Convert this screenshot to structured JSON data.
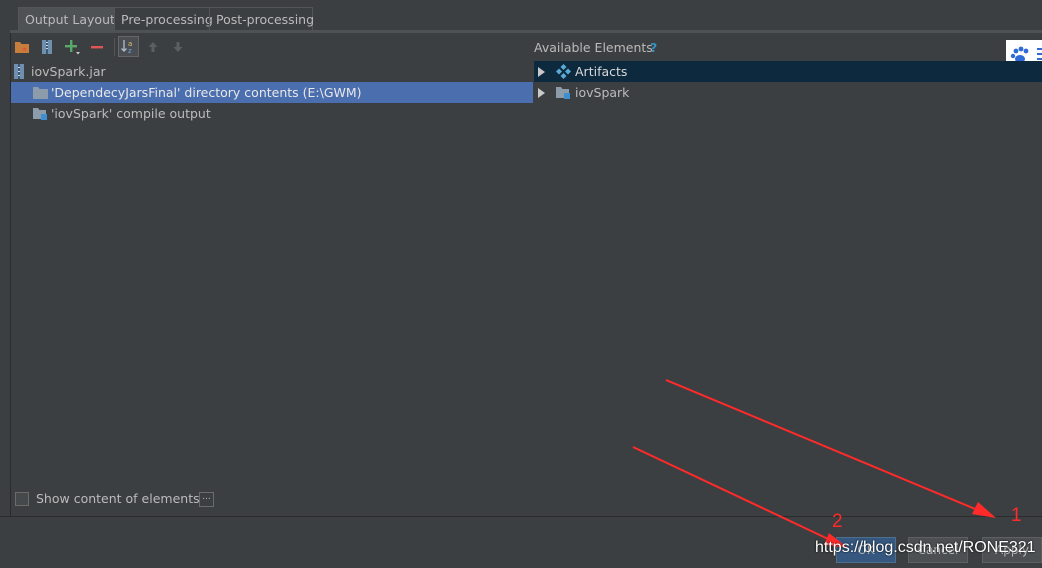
{
  "tabs": [
    {
      "label": "Output Layout",
      "active": true
    },
    {
      "label": "Pre-processing",
      "active": false
    },
    {
      "label": "Post-processing",
      "active": false
    }
  ],
  "toolbar": {
    "icons": [
      "create-directory-icon",
      "archive-icon",
      "add-icon",
      "remove-icon",
      "sort-icon",
      "move-up-icon",
      "move-down-icon"
    ]
  },
  "output_tree": {
    "root": "iovSpark.jar",
    "items": [
      {
        "label": "'DependecyJarsFinal' directory contents (E:\\GWM)",
        "selected": true
      },
      {
        "label": "'iovSpark' compile output",
        "selected": false
      }
    ]
  },
  "available": {
    "title": "Available Elements",
    "help": "?",
    "items": [
      {
        "label": "Artifacts",
        "selected": true
      },
      {
        "label": "iovSpark",
        "selected": false
      }
    ]
  },
  "bottom": {
    "show_content_label": "Show content of elements",
    "show_content_checked": false,
    "more_label": "..."
  },
  "buttons": {
    "ok": "OK",
    "cancel": "Cancel",
    "apply": "Apply"
  },
  "annotations": {
    "one": "1",
    "two": "2"
  },
  "watermark": "https://blog.csdn.net/RONE321",
  "colors": {
    "background": "#3c3f41",
    "selection": "#4b6eaf",
    "accent_arrow": "#ff2a2a"
  }
}
